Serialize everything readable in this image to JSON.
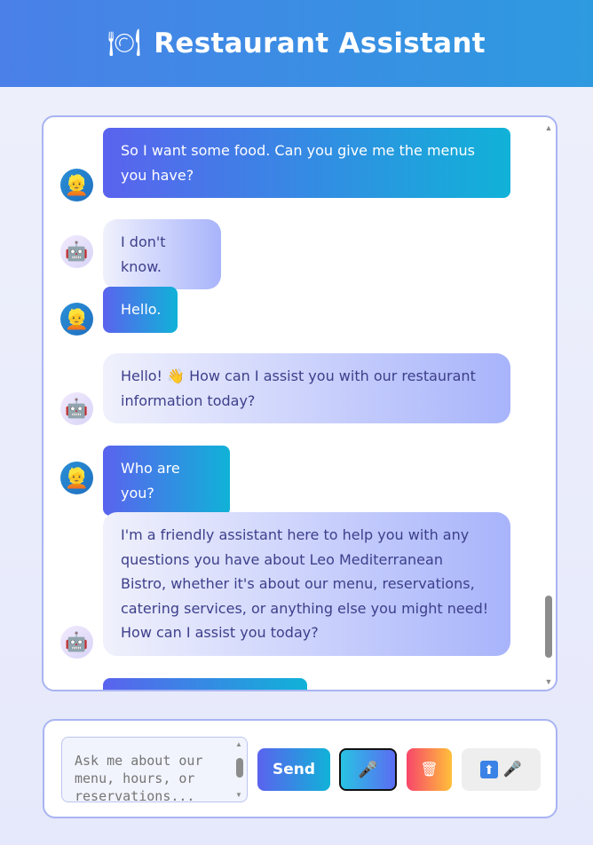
{
  "header": {
    "icon": "🍽",
    "title": "Restaurant Assistant"
  },
  "messages": [
    {
      "role": "user",
      "text": "So I want some food. Can you give me the menus you have?"
    },
    {
      "role": "bot",
      "text": "I don't know."
    },
    {
      "role": "user",
      "text": "Hello."
    },
    {
      "role": "bot",
      "text": "Hello! 👋 How can I assist you with our restaurant information today?"
    },
    {
      "role": "user",
      "text": "Who are you?"
    },
    {
      "role": "bot",
      "text": "I'm a friendly assistant here to help you with any questions you have about Leo Mediterranean Bistro, whether it's about our menu, reservations, catering services, or anything else you might need! How can I assist you today?"
    }
  ],
  "avatars": {
    "user": "👱",
    "bot": "🤖"
  },
  "input": {
    "placeholder": "Ask me about our menu, hours, or reservations...",
    "value": ""
  },
  "buttons": {
    "send_label": "Send",
    "mic_icon": "🎤",
    "clear_icon": "🗑",
    "upload_icon": "⬆",
    "upload_mic_icon": "🎤"
  },
  "colors": {
    "header_start": "#4a80e8",
    "header_end": "#2d9ae0",
    "user_bubble_start": "#5a63ee",
    "user_bubble_end": "#10b2d8",
    "bot_bubble_start": "#f0f1fc",
    "bot_bubble_end": "#a8b4fb",
    "border": "#a9b4f2"
  }
}
